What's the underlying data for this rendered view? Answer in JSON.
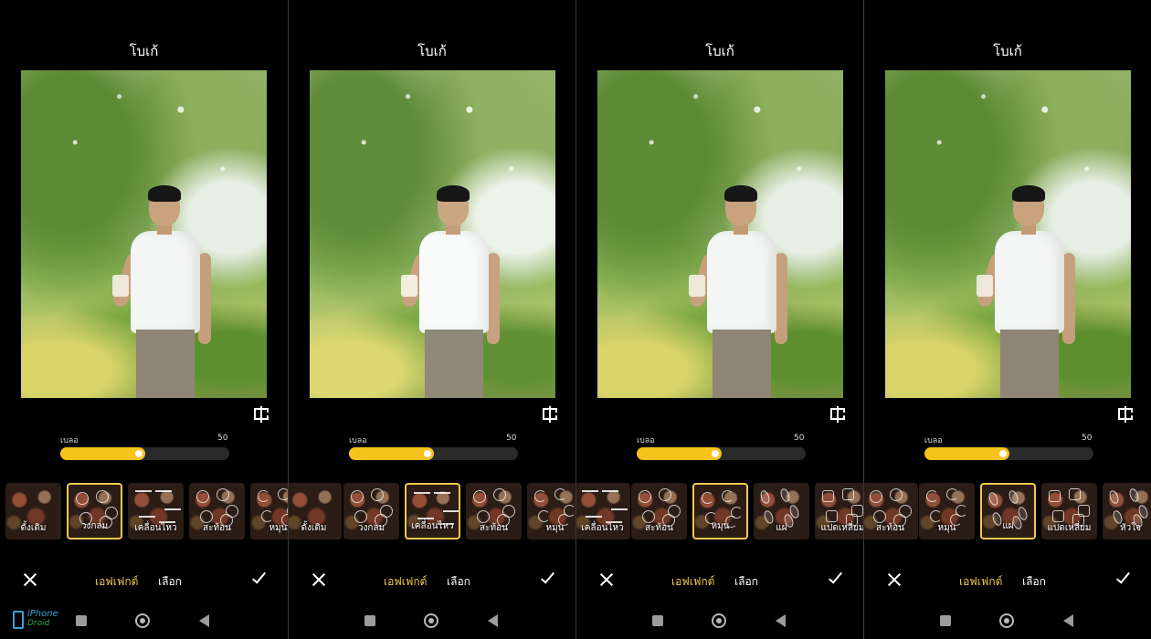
{
  "screens": [
    {
      "title": "โบเก้",
      "slider": {
        "label": "เบลอ",
        "value": "50",
        "fraction": 0.5
      },
      "effects": [
        "ดั้งเดิม",
        "วงกลม",
        "เคลื่อนไหว",
        "สะท้อน",
        "หมุน"
      ],
      "selected_index": 1,
      "tabs": {
        "effect": "เอฟเฟกต์",
        "select": "เลือก"
      }
    },
    {
      "title": "โบเก้",
      "slider": {
        "label": "เบลอ",
        "value": "50",
        "fraction": 0.5
      },
      "effects": [
        "ดั้งเดิม",
        "วงกลม",
        "เคลื่อนไหว",
        "สะท้อน",
        "หมุน"
      ],
      "selected_index": 2,
      "tabs": {
        "effect": "เอฟเฟกต์",
        "select": "เลือก"
      }
    },
    {
      "title": "โบเก้",
      "slider": {
        "label": "เบลอ",
        "value": "50",
        "fraction": 0.5
      },
      "effects": [
        "เคลื่อนไหว",
        "สะท้อน",
        "หมุน",
        "แผ่",
        "แปดเหลี่ยม"
      ],
      "selected_index": 2,
      "tabs": {
        "effect": "เอฟเฟกต์",
        "select": "เลือก"
      }
    },
    {
      "title": "โบเก้",
      "slider": {
        "label": "เบลอ",
        "value": "50",
        "fraction": 0.5
      },
      "effects": [
        "สะท้อน",
        "หมุน",
        "แผ่",
        "แปดเหลี่ยม",
        "หัวใจ"
      ],
      "selected_index": 2,
      "tabs": {
        "effect": "เอฟเฟกต์",
        "select": "เลือก"
      }
    }
  ],
  "watermark": {
    "line1": "iPhone",
    "line2": "Droid"
  },
  "colors": {
    "accent": "#f3c94f",
    "slider_fill": "#f6c31a",
    "background": "#000000"
  }
}
